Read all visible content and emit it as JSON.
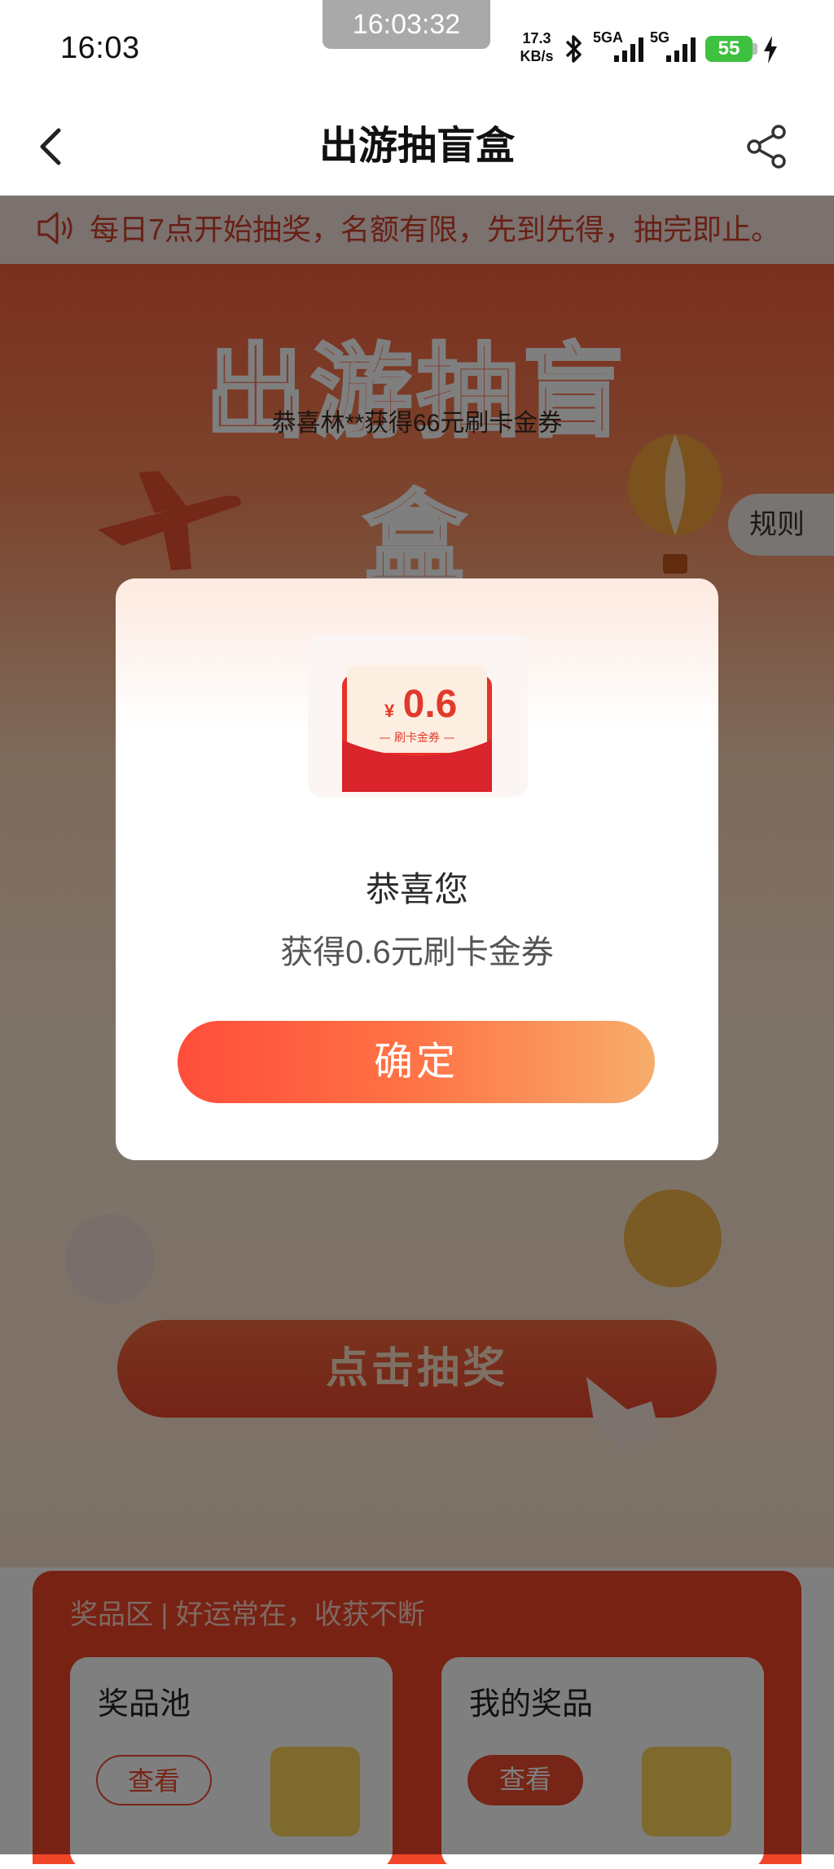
{
  "status_bar": {
    "time": "16:03",
    "screenshot_time": "16:03:32",
    "net_speed_value": "17.3",
    "net_speed_unit": "KB/s",
    "signal1_label": "5GA",
    "signal2_label": "5G",
    "battery_level": "55",
    "icons": [
      "bluetooth-icon",
      "signal-icon",
      "signal-icon",
      "battery-icon",
      "charging-icon"
    ]
  },
  "header": {
    "title": "出游抽盲盒",
    "back_icon": "chevron-left-icon",
    "share_icon": "share-icon"
  },
  "notice": {
    "text": "每日7点开始抽奖，名额有限，先到先得，抽完即止。",
    "icon": "speaker-icon"
  },
  "hero": {
    "title": "出游抽盲盒",
    "winner_text": "恭喜林**获得66元刷卡金券",
    "rules_label": "规则",
    "cta_label": "点击抽奖"
  },
  "prize_area": {
    "header": "奖品区 | 好运常在，收获不断",
    "cards": [
      {
        "title": "奖品池",
        "button": "查看"
      },
      {
        "title": "我的奖品",
        "button": "查看"
      }
    ]
  },
  "dialog": {
    "coupon": {
      "currency": "¥",
      "amount": "0.6",
      "label": "— 刷卡金券 —"
    },
    "title": "恭喜您",
    "description": "获得0.6元刷卡金券",
    "confirm_label": "确定"
  },
  "colors": {
    "accent": "#ef4a2c",
    "notice_text": "#d2402a",
    "button_gradient_start": "#ff4d3a",
    "button_gradient_end": "#f6ad6c"
  }
}
